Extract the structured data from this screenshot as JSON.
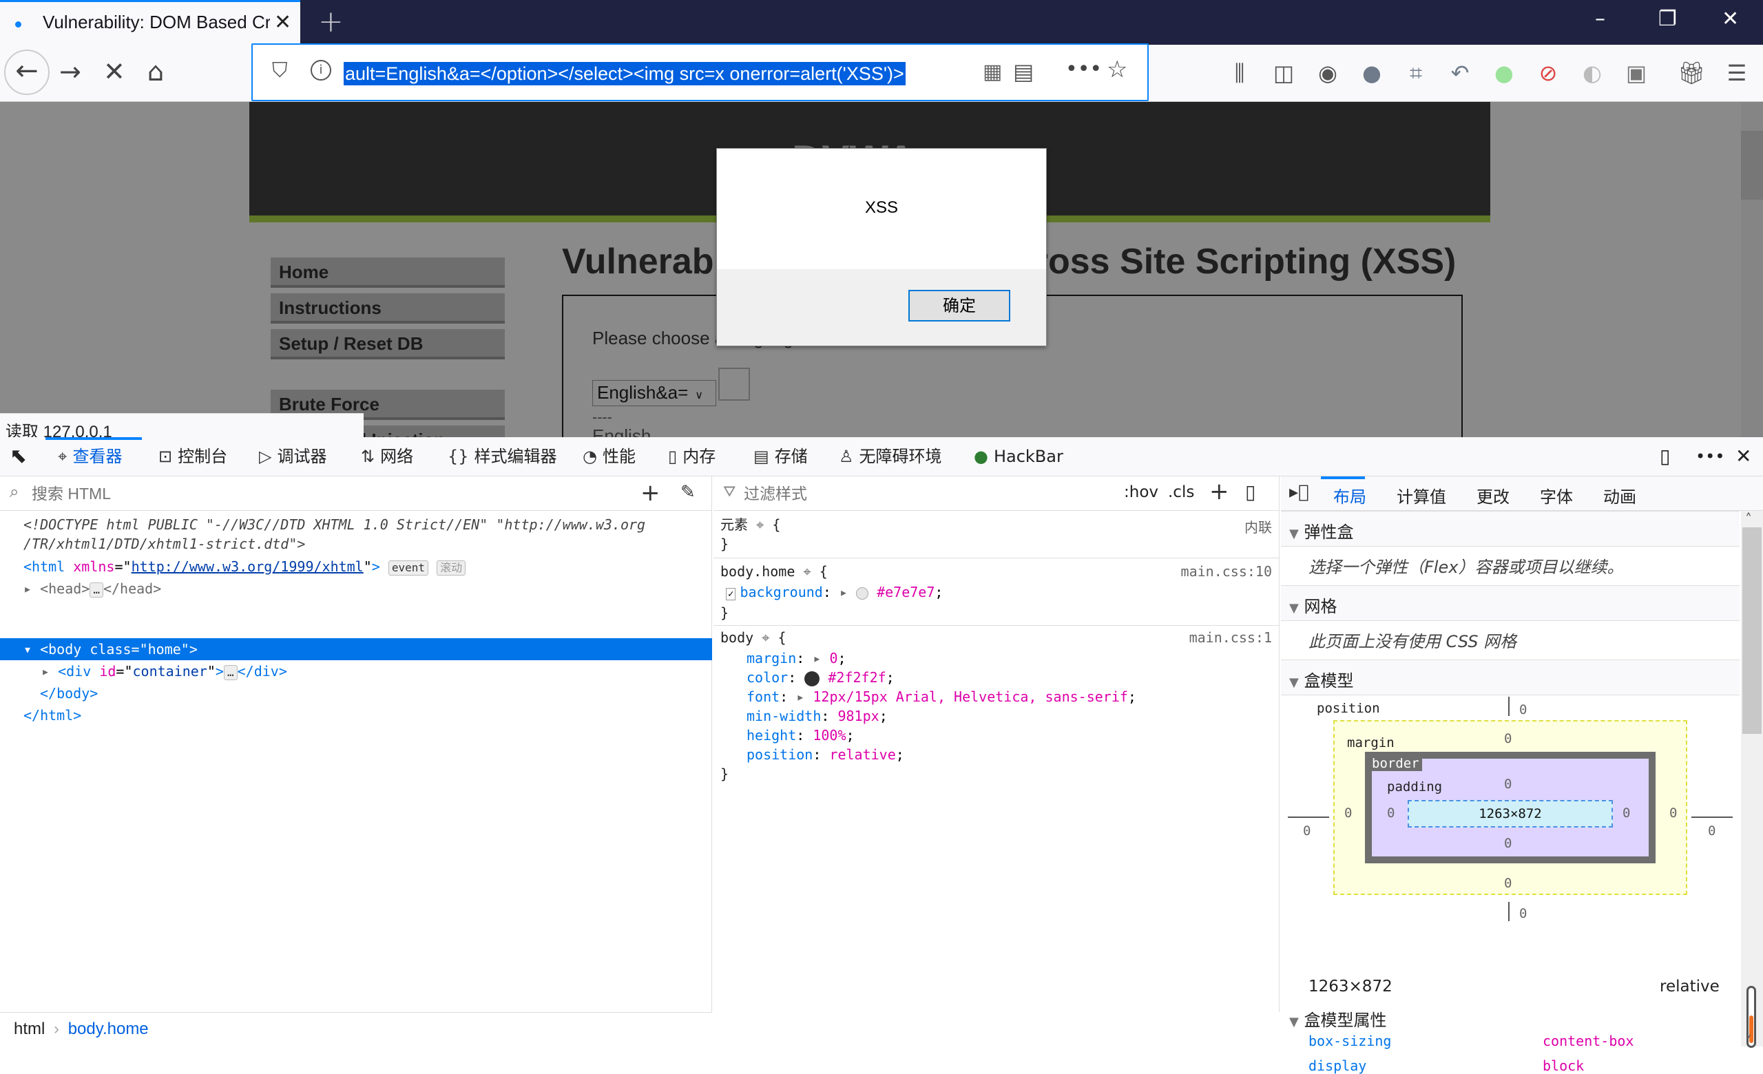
{
  "browser": {
    "tab_title": "Vulnerability: DOM Based Cr",
    "new_tab": "+",
    "window": {
      "minimize": "–",
      "restore": "❐",
      "close": "✕"
    },
    "url_selected": "ault=English&a=</option></select><img src=x onerror=alert('XSS')>",
    "toolbar_icons": [
      "library-icon",
      "sidebar-icon",
      "account-icon",
      "chat-icon",
      "crop-icon",
      "undo-icon",
      "green-dot-icon",
      "blocked-icon",
      "extension-icon",
      "tiles-icon",
      "gift-icon",
      "menu-icon"
    ]
  },
  "page": {
    "logo": "DVWA",
    "menu": [
      "Home",
      "Instructions",
      "Setup / Reset DB",
      "Brute Force",
      "Command Injection"
    ],
    "title": "Vulnerability: DOM Based Cross Site Scripting (XSS)",
    "choose_text": "Please choose a language:",
    "select_value": "English&a=",
    "dashes": "----",
    "option_english": "English"
  },
  "alert": {
    "message": "XSS",
    "ok": "确定"
  },
  "status": "读取 127.0.0.1",
  "devtools": {
    "tabs": [
      {
        "label": "查看器",
        "icon": "inspector-icon",
        "active": true
      },
      {
        "label": "控制台",
        "icon": "console-icon"
      },
      {
        "label": "调试器",
        "icon": "debugger-icon"
      },
      {
        "label": "网络",
        "icon": "network-icon"
      },
      {
        "label": "样式编辑器",
        "icon": "style-editor-icon"
      },
      {
        "label": "性能",
        "icon": "performance-icon"
      },
      {
        "label": "内存",
        "icon": "memory-icon"
      },
      {
        "label": "存储",
        "icon": "storage-icon"
      },
      {
        "label": "无障碍环境",
        "icon": "accessibility-icon"
      },
      {
        "label": "HackBar",
        "icon": "hackbar-icon"
      }
    ],
    "search_placeholder": "搜索 HTML",
    "markup": {
      "doctype1": "<!DOCTYPE html PUBLIC \"-//W3C//DTD XHTML 1.0 Strict//EN\" \"http://www.w3.org",
      "doctype2": "/TR/xhtml1/DTD/xhtml1-strict.dtd\">",
      "html_xmlns": "http://www.w3.org/1999/xhtml",
      "badge_event": "event",
      "badge_scroll": "滚动",
      "body_class": "home",
      "div_id": "container"
    },
    "rules": {
      "filter_placeholder": "过滤样式",
      "hov": ":hov",
      "cls": ".cls",
      "element_label": "元素",
      "inline": "内联",
      "rule1_selector": "body.home",
      "rule1_src": "main.css:10",
      "rule1_prop": "background",
      "rule1_val": "#e7e7e7",
      "rule2_selector": "body",
      "rule2_src": "main.css:1",
      "rule2_props": [
        {
          "name": "margin",
          "value": "0"
        },
        {
          "name": "color",
          "value": "#2f2f2f"
        },
        {
          "name": "font",
          "value": "12px/15px Arial, Helvetica, sans-serif"
        },
        {
          "name": "min-width",
          "value": "981px"
        },
        {
          "name": "height",
          "value": "100%"
        },
        {
          "name": "position",
          "value": "relative"
        }
      ]
    },
    "layout": {
      "tabs": [
        "布局",
        "计算值",
        "更改",
        "字体",
        "动画"
      ],
      "flex_title": "弹性盒",
      "flex_msg": "选择一个弹性（Flex）容器或项目以继续。",
      "grid_title": "网格",
      "grid_msg": "此页面上没有使用 CSS 网格",
      "box_title": "盒模型",
      "position_label": "position",
      "margin_label": "margin",
      "border_label": "border",
      "padding_label": "padding",
      "content_size": "1263×872",
      "zero": "0",
      "size_summary": "1263×872",
      "position_value": "relative",
      "props_title": "盒模型属性",
      "props": [
        {
          "name": "box-sizing",
          "value": "content-box"
        },
        {
          "name": "display",
          "value": "block"
        }
      ]
    },
    "breadcrumbs": [
      "html",
      "body.home"
    ]
  }
}
